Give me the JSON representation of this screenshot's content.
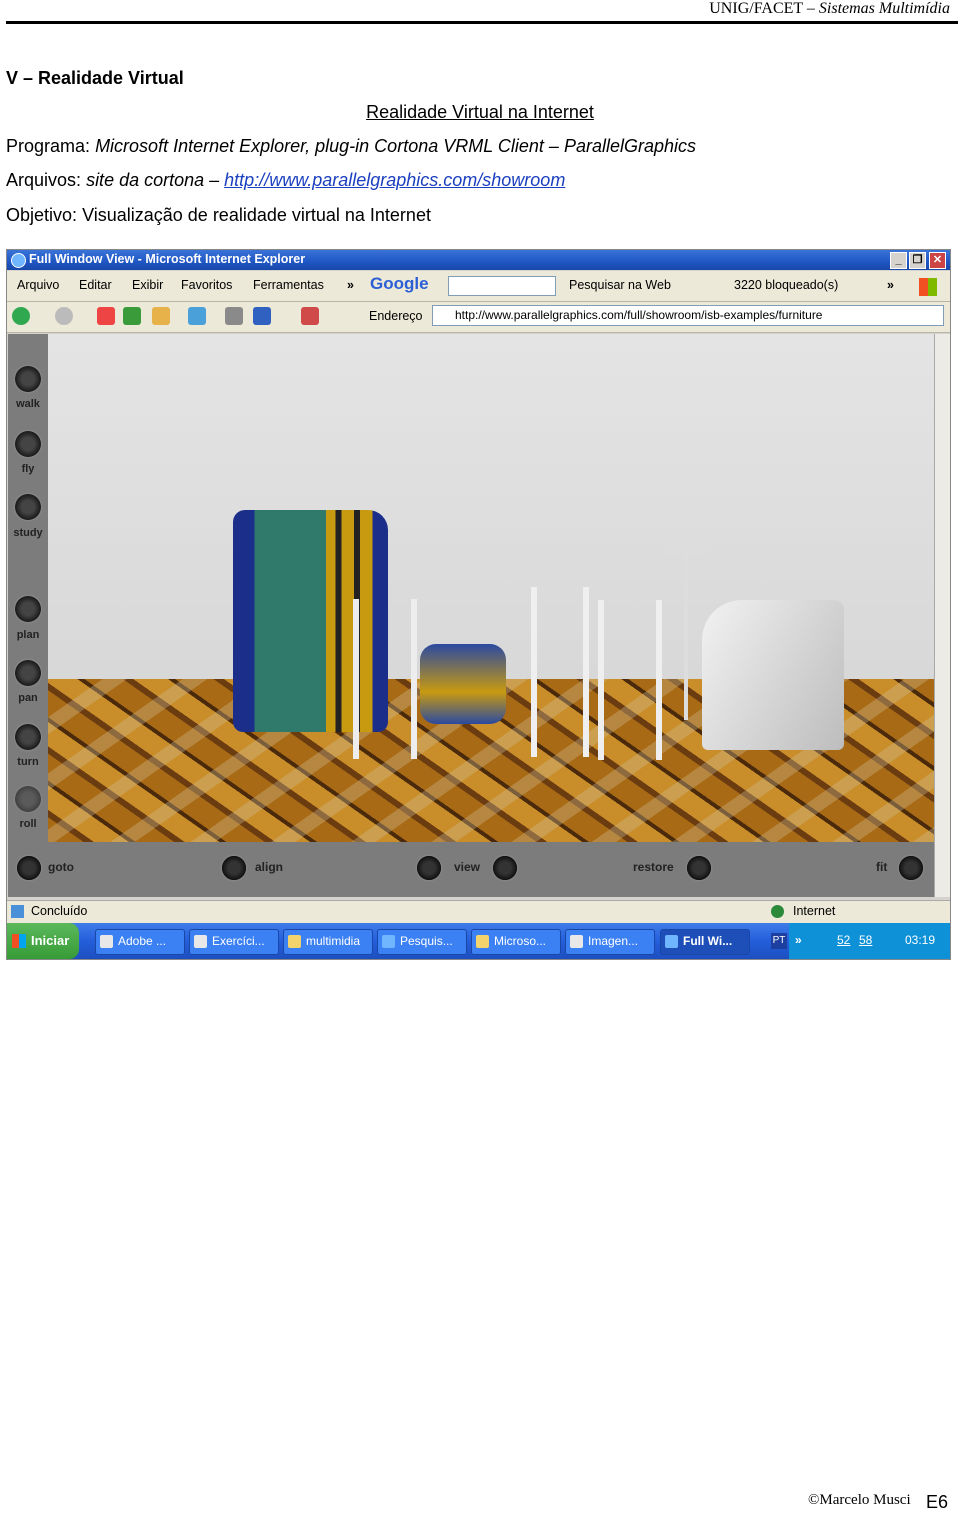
{
  "header": {
    "institution": "UNIG/FACET",
    "dash": "–",
    "course": "Sistemas Multimídia"
  },
  "section_title": "V – Realidade Virtual",
  "subtitle": "Realidade Virtual na Internet",
  "program": {
    "label": "Programa:",
    "value": "Microsoft Internet Explorer, plug-in Cortona VRML Client – ParallelGraphics"
  },
  "files": {
    "label": "Arquivos:",
    "value": "site da cortona –",
    "link": "http://www.parallelgraphics.com/showroom"
  },
  "objective": {
    "label": "Objetivo:",
    "value": "Visualização de realidade virtual na Internet"
  },
  "browser": {
    "title": "Full Window View - Microsoft Internet Explorer",
    "window_buttons": [
      "_",
      "❐",
      "✕"
    ],
    "menu": [
      "Arquivo",
      "Editar",
      "Exibir",
      "Favoritos",
      "Ferramentas"
    ],
    "menu_more": "»",
    "google_logo": "Google",
    "google_search": "Pesquisar na Web",
    "blocked": "3220 bloqueado(s)",
    "address_label": "Endereço",
    "address": "http://www.parallelgraphics.com/full/showroom/isb-examples/furniture",
    "status": "Concluído",
    "zone": "Internet"
  },
  "cortona": {
    "side_buttons": [
      "walk",
      "fly",
      "study",
      "plan",
      "pan",
      "turn",
      "roll"
    ],
    "bottom_buttons": [
      "goto",
      "align",
      "view",
      "restore",
      "fit"
    ]
  },
  "taskbar": {
    "start": "Iniciar",
    "items": [
      "Adobe ...",
      "Exercíci...",
      "multimidia",
      "Pesquis...",
      "Microso...",
      "Imagen...",
      "Full Wi..."
    ],
    "lang": "PT",
    "clock": "03:19",
    "tray_nums": [
      "52",
      "58"
    ]
  },
  "footer": {
    "author": "©Marcelo Musci",
    "page": "E6"
  },
  "colors": {
    "title_bar": "#245edb",
    "link": "#1a3fbf"
  }
}
